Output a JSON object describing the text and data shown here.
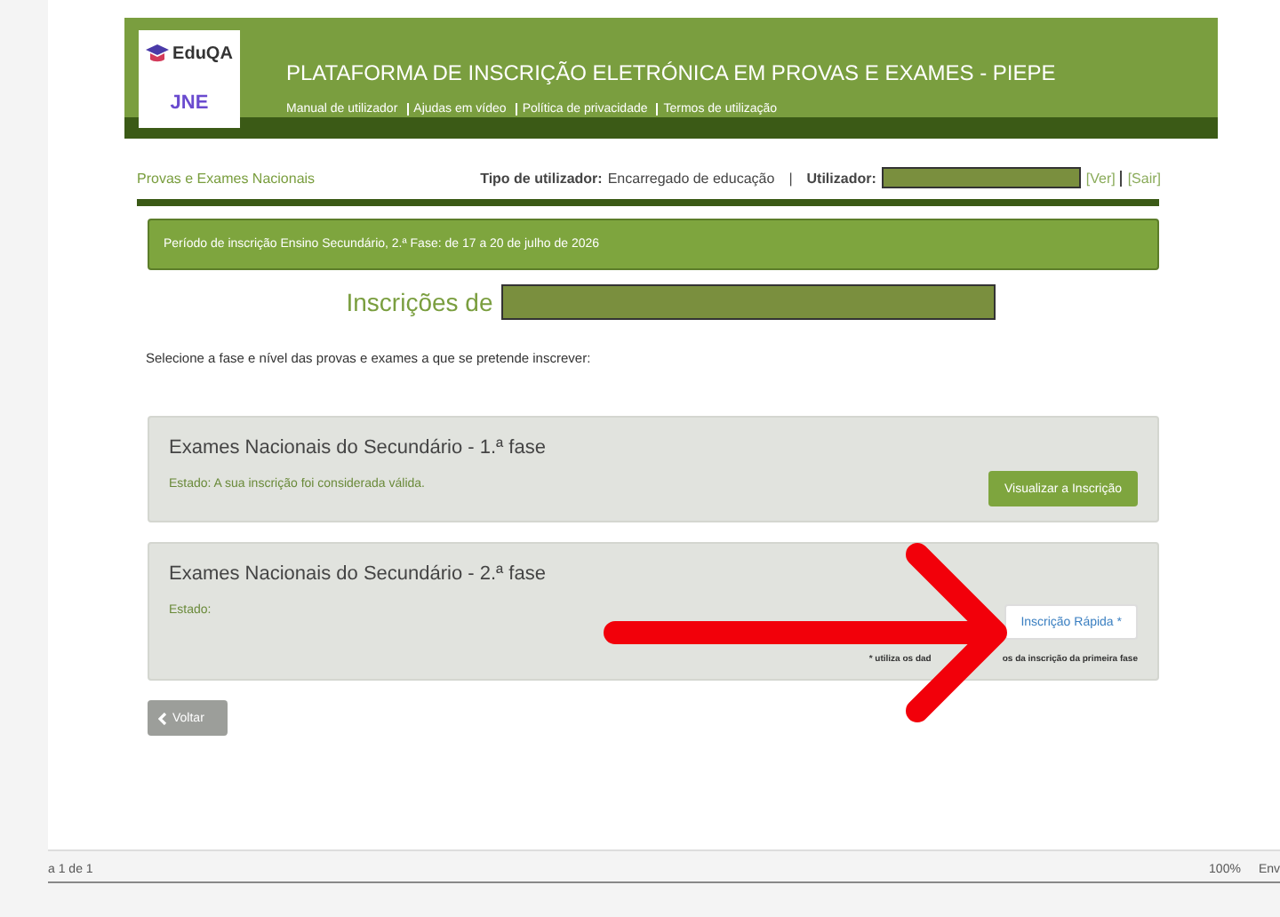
{
  "header": {
    "logo_top": "EduQA",
    "logo_bottom": "JNE",
    "title": "PLATAFORMA DE INSCRIÇÃO ELETRÓNICA EM PROVAS E EXAMES - PIEPE",
    "links": [
      "Manual de utilizador",
      "Ajudas em vídeo",
      "Política de privacidade",
      "Termos de utilização"
    ]
  },
  "userbar": {
    "section": "Provas e Exames Nacionais",
    "type_label": "Tipo de utilizador:",
    "type_value": "Encarregado de educação",
    "separator": "|",
    "user_label": "Utilizador:",
    "actions": [
      "[Ver]",
      "[Sair]"
    ]
  },
  "notice": "Período de inscrição Ensino Secundário, 2.ª Fase: de 17 a 20 de julho de 2026",
  "heading": "Inscrições de",
  "instruction": "Selecione a fase e nível das provas e exames a que se pretende inscrever:",
  "cards": [
    {
      "title": "Exames Nacionais do Secundário - 1.ª fase",
      "status": "Estado: A sua inscrição foi considerada válida.",
      "button": "Visualizar a Inscrição",
      "kind": "view"
    },
    {
      "title": "Exames Nacionais do Secundário - 2.ª fase",
      "status": "Estado:",
      "button": "Inscrição Rápida *",
      "kind": "quick",
      "note_parts": [
        "* utiliza os dad",
        "os da inscrição da primeira fase"
      ]
    }
  ],
  "back_button": "Voltar",
  "viewer_status": {
    "page": "a 1 de 1",
    "zoom": "100%",
    "action": "Env"
  }
}
